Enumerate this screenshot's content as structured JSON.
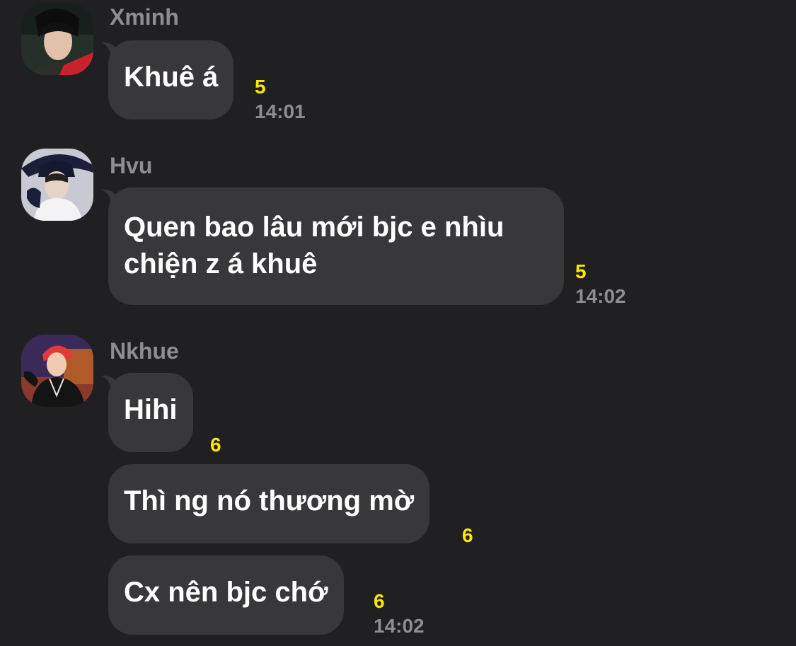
{
  "theme": {
    "background": "#202022",
    "bubble": "#38383a",
    "text": "#ffffff",
    "meta": "#8e8e92",
    "unread_count": "#ffe600"
  },
  "messages": [
    {
      "sender": "Xminh",
      "avatar": "avatar-icon",
      "bubbles": [
        {
          "text": "Khuê á",
          "count": "5",
          "time": "14:01"
        }
      ]
    },
    {
      "sender": "Hvu",
      "avatar": "avatar-icon",
      "bubbles": [
        {
          "line1": "Quen bao lâu mới bjc e nhìu",
          "line2": "chiện z á khuê",
          "count": "5",
          "time": "14:02"
        }
      ]
    },
    {
      "sender": "Nkhue",
      "avatar": "avatar-icon",
      "bubbles": [
        {
          "text": "Hihi",
          "count": "6"
        },
        {
          "text": "Thì ng nó thương mờ",
          "count": "6"
        },
        {
          "text": "Cx nên bjc chớ",
          "count": "6",
          "time": "14:02"
        }
      ]
    }
  ]
}
